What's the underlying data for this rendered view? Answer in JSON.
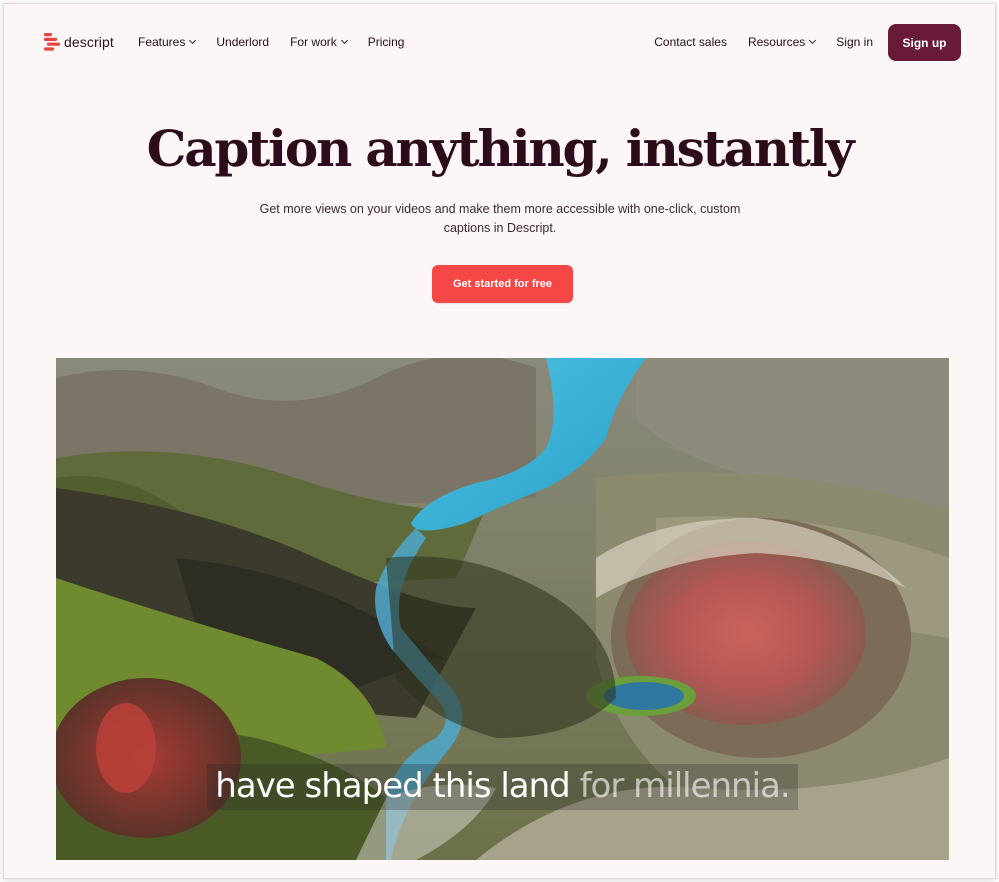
{
  "brand": {
    "name": "descript",
    "accent": "#e8433f",
    "primary": "#6a1a39"
  },
  "nav": {
    "left": [
      {
        "label": "Features",
        "has_dropdown": true
      },
      {
        "label": "Underlord",
        "has_dropdown": false
      },
      {
        "label": "For work",
        "has_dropdown": true
      },
      {
        "label": "Pricing",
        "has_dropdown": false
      }
    ],
    "right": [
      {
        "label": "Contact sales",
        "has_dropdown": false
      },
      {
        "label": "Resources",
        "has_dropdown": true
      },
      {
        "label": "Sign in",
        "has_dropdown": false
      }
    ],
    "signup_label": "Sign up"
  },
  "hero": {
    "title": "Caption anything, instantly",
    "subtitle": "Get more views on your videos and make them more accessible with one-click, custom captions in Descript.",
    "cta_label": "Get started for free",
    "cta_color": "#f44746"
  },
  "video": {
    "caption_spoken": "have shaped this land",
    "caption_upcoming": "for millennia."
  }
}
